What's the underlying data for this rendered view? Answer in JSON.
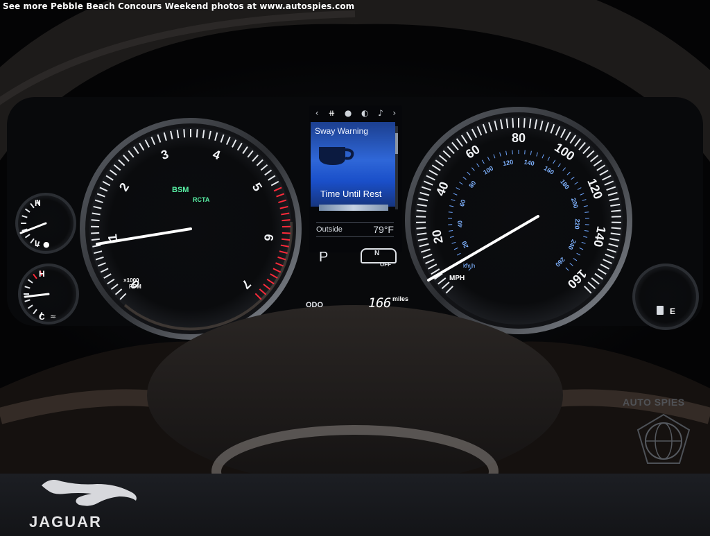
{
  "caption": "See more Pebble Beach Concours Weekend photos at www.autospies.com",
  "tachometer": {
    "numbers": [
      "0",
      "1",
      "2",
      "3",
      "4",
      "5",
      "6",
      "7"
    ],
    "unit_line1": "×1000",
    "unit_line2": "RPM",
    "indicator_bsm": "BSM",
    "indicator_rcta": "RCTA",
    "needle_value": 1.1
  },
  "speedometer": {
    "mph_numbers": [
      "20",
      "40",
      "60",
      "80",
      "100",
      "120",
      "140",
      "160"
    ],
    "kmh_numbers": [
      "20",
      "40",
      "60",
      "80",
      "100",
      "120",
      "140",
      "160",
      "180",
      "200",
      "220",
      "240",
      "260"
    ],
    "mph_label": "MPH",
    "kmh_label": "km/h",
    "needle_value": 16
  },
  "display": {
    "menu_icons": [
      "chevron-left-icon",
      "road-icon",
      "car-icon",
      "gauge-icon",
      "music-icon",
      "chevron-right-icon"
    ],
    "warning_title": "Sway Warning",
    "rest_title": "Time Until Rest",
    "outside_label": "Outside",
    "outside_temp": "79°F",
    "gear": "P",
    "offroad_label": "OFF",
    "offroad_letter": "N"
  },
  "odometer": {
    "label": "ODO",
    "value": "166",
    "unit": "miles"
  },
  "temp_gauge": {
    "high": "H",
    "low": "L"
  },
  "coolant_gauge": {
    "high": "H",
    "low": "C"
  },
  "fuel_gauge": {
    "empty": "E"
  },
  "watermark": "AUTO SPIES",
  "brand": {
    "name": "JAGUAR"
  }
}
